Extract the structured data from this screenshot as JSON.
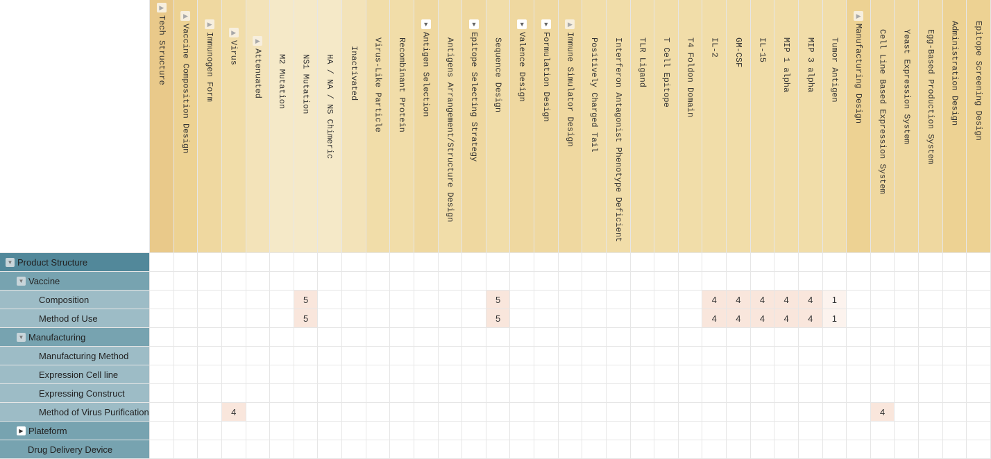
{
  "columns": [
    {
      "label": "Tech Structure",
      "level": 0,
      "toggle": "collapsed"
    },
    {
      "label": "Vaccine Composition Design",
      "level": 1,
      "toggle": "collapsed"
    },
    {
      "label": "Immunogen Form",
      "level": 2,
      "toggle": "collapsed"
    },
    {
      "label": "Virus",
      "level": 3,
      "toggle": "collapsed"
    },
    {
      "label": "Attenuated",
      "level": 4,
      "toggle": "collapsed"
    },
    {
      "label": "M2 Mutation",
      "level": 5
    },
    {
      "label": "NS1 Mutation",
      "level": 5
    },
    {
      "label": "HA / NA / NS Chimeric",
      "level": 5
    },
    {
      "label": "Inactivated",
      "level": 4
    },
    {
      "label": "Virus-Like Particle",
      "level": 3
    },
    {
      "label": "Recombinant Protein",
      "level": 3
    },
    {
      "label": "Antigen Selection",
      "level": 2,
      "toggle": "expanded"
    },
    {
      "label": "Antigens Arrangement/Structure Design",
      "level": 3
    },
    {
      "label": "Epitope Selecting Strategy",
      "level": 2,
      "toggle": "expanded"
    },
    {
      "label": "Sequence Design",
      "level": 3
    },
    {
      "label": "Valence Design",
      "level": 2,
      "toggle": "expanded"
    },
    {
      "label": "Formulation Design",
      "level": 2,
      "toggle": "expanded"
    },
    {
      "label": "Immune Simulator Design",
      "level": 2,
      "toggle": "collapsed"
    },
    {
      "label": "Positively Charged Tail",
      "level": 3
    },
    {
      "label": "Interferon Antagonist Phenotype Deficient",
      "level": 3
    },
    {
      "label": "TLR Ligand",
      "level": 3
    },
    {
      "label": "T Cell Epitope",
      "level": 3
    },
    {
      "label": "T4 Foldon Domain",
      "level": 3
    },
    {
      "label": "IL-2",
      "level": 3
    },
    {
      "label": "GM-CSF",
      "level": 3
    },
    {
      "label": "IL-15",
      "level": 3
    },
    {
      "label": "MIP 1 alpha",
      "level": 3
    },
    {
      "label": "MIP 3 alpha",
      "level": 3
    },
    {
      "label": "Tumor Antigen",
      "level": 3
    },
    {
      "label": "Manufacturing Design",
      "level": 1,
      "toggle": "collapsed"
    },
    {
      "label": "Cell Line Based Expression System",
      "level": 2
    },
    {
      "label": "Yeast Expression System",
      "level": 2
    },
    {
      "label": "Egg-Based Production System",
      "level": 2
    },
    {
      "label": "Administration Design",
      "level": 1
    },
    {
      "label": "Epitope Screening Design",
      "level": 1
    }
  ],
  "rows": [
    {
      "label": "Product Structure",
      "level": 0,
      "toggle": "expanded",
      "values": {}
    },
    {
      "label": "Vaccine",
      "level": 1,
      "toggle": "expanded",
      "values": {}
    },
    {
      "label": "Composition",
      "level": 2,
      "values": {
        "6": 5,
        "14": 5,
        "23": 4,
        "24": 4,
        "25": 4,
        "26": 4,
        "27": 4,
        "28": 1
      }
    },
    {
      "label": "Method of Use",
      "level": 2,
      "values": {
        "6": 5,
        "14": 5,
        "23": 4,
        "24": 4,
        "25": 4,
        "26": 4,
        "27": 4,
        "28": 1
      }
    },
    {
      "label": "Manufacturing",
      "level": 1,
      "toggle": "expanded",
      "values": {}
    },
    {
      "label": "Manufacturing Method",
      "level": 2,
      "values": {}
    },
    {
      "label": "Expression Cell line",
      "level": 2,
      "values": {}
    },
    {
      "label": "Expressing Construct",
      "level": 2,
      "values": {}
    },
    {
      "label": "Method of Virus Purification",
      "level": 2,
      "values": {
        "3": 4,
        "30": 4
      }
    },
    {
      "label": "Plateform",
      "level": 1,
      "toggle": "collapsed",
      "values": {}
    },
    {
      "label": "Drug Delivery Device",
      "level": 1,
      "values": {}
    }
  ],
  "colors": {
    "header_levels": [
      "#e9c98a",
      "#edd293",
      "#efd8a0",
      "#f1dda9",
      "#f3e3b9",
      "#f5e9c8"
    ],
    "row_levels": [
      "#52889a",
      "#77a3b0",
      "#9dbcc6"
    ],
    "cell_high": "#f9e6dc",
    "cell_low": "#fcf3ee"
  }
}
